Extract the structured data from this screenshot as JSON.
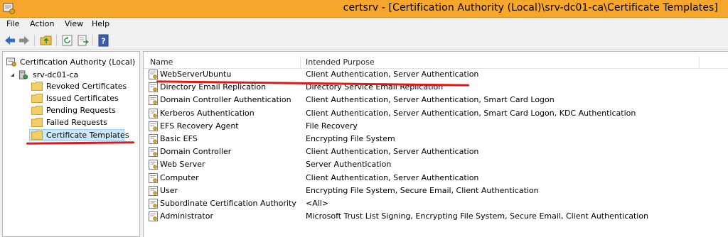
{
  "window": {
    "title": "certsrv - [Certification Authority (Local)\\srv-dc01-ca\\Certificate Templates]"
  },
  "menu": [
    "File",
    "Action",
    "View",
    "Help"
  ],
  "toolbar": {
    "buttons": [
      "back-arrow-icon",
      "forward-arrow-icon",
      "up-folder-icon",
      "refresh-icon",
      "export-list-icon",
      "help-icon"
    ]
  },
  "tree": {
    "root": "Certification Authority (Local)",
    "ca": "srv-dc01-ca",
    "folders": [
      "Revoked Certificates",
      "Issued Certificates",
      "Pending Requests",
      "Failed Requests",
      "Certificate Templates"
    ],
    "selected": "Certificate Templates"
  },
  "list": {
    "columns": [
      "Name",
      "Intended Purpose"
    ],
    "rows": [
      {
        "name": "WebServerUbuntu",
        "purpose": "Client Authentication, Server Authentication"
      },
      {
        "name": "Directory Email Replication",
        "purpose": "Directory Service Email Replication"
      },
      {
        "name": "Domain Controller Authentication",
        "purpose": "Client Authentication, Server Authentication, Smart Card Logon"
      },
      {
        "name": "Kerberos Authentication",
        "purpose": "Client Authentication, Server Authentication, Smart Card Logon, KDC Authentication"
      },
      {
        "name": "EFS Recovery Agent",
        "purpose": "File Recovery"
      },
      {
        "name": "Basic EFS",
        "purpose": "Encrypting File System"
      },
      {
        "name": "Domain Controller",
        "purpose": "Client Authentication, Server Authentication"
      },
      {
        "name": "Web Server",
        "purpose": "Server Authentication"
      },
      {
        "name": "Computer",
        "purpose": "Client Authentication, Server Authentication"
      },
      {
        "name": "User",
        "purpose": "Encrypting File System, Secure Email, Client Authentication"
      },
      {
        "name": "Subordinate Certification Authority",
        "purpose": "<All>"
      },
      {
        "name": "Administrator",
        "purpose": "Microsoft Trust List Signing, Encrypting File System, Secure Email, Client Authentication"
      }
    ]
  },
  "colors": {
    "titlebar": "#f6a62a",
    "annotation": "#e01818",
    "selection": "#cce8ff"
  }
}
